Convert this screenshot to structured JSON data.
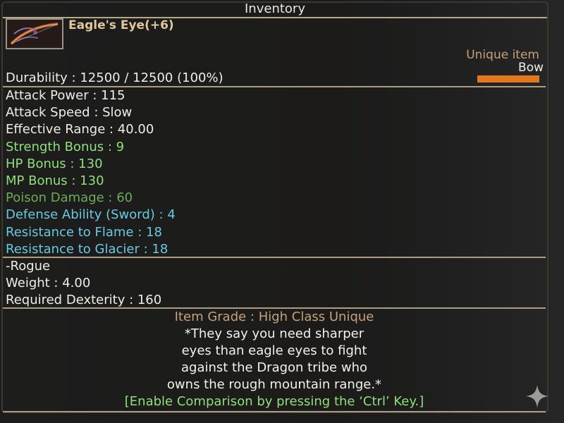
{
  "window": {
    "title": "Inventory"
  },
  "item": {
    "name": "Eagle's Eye(+6)",
    "icon": "bow-icon",
    "rarity": "Unique item",
    "type": "Bow",
    "durability_text": "Durability : 12500 / 12500 (100%)",
    "durability_fraction": 1.0
  },
  "stats": [
    {
      "text": "Attack Power : 115",
      "color": "#f0ede6"
    },
    {
      "text": "Attack Speed : Slow",
      "color": "#f0ede6"
    },
    {
      "text": "Effective Range : 40.00",
      "color": "#f0ede6"
    },
    {
      "text": "Strength Bonus : 9",
      "color": "#8fe07c"
    },
    {
      "text": "HP Bonus : 130",
      "color": "#8fe07c"
    },
    {
      "text": "MP Bonus : 130",
      "color": "#8fe07c"
    },
    {
      "text": "Poison Damage : 60",
      "color": "#6bab59"
    },
    {
      "text": "Defense Ability (Sword) : 4",
      "color": "#68c9e2"
    },
    {
      "text": "Resistance to Flame : 18",
      "color": "#68c9e2"
    },
    {
      "text": "Resistance to Glacier : 18",
      "color": "#68c9e2"
    }
  ],
  "requirements": {
    "class": " -Rogue",
    "weight": "Weight : 4.00",
    "required_dexterity": "Required Dexterity : 160"
  },
  "grade": "Item Grade : High Class Unique",
  "description": [
    "*They say you need sharper",
    "eyes than eagle eyes to fight",
    "against the Dragon tribe who",
    "owns the rough mountain range.*"
  ],
  "compare_hint": "[Enable Comparison by pressing the ‘Ctrl’ Key.]",
  "decor": {
    "corner_icon": "sparkle-icon"
  }
}
